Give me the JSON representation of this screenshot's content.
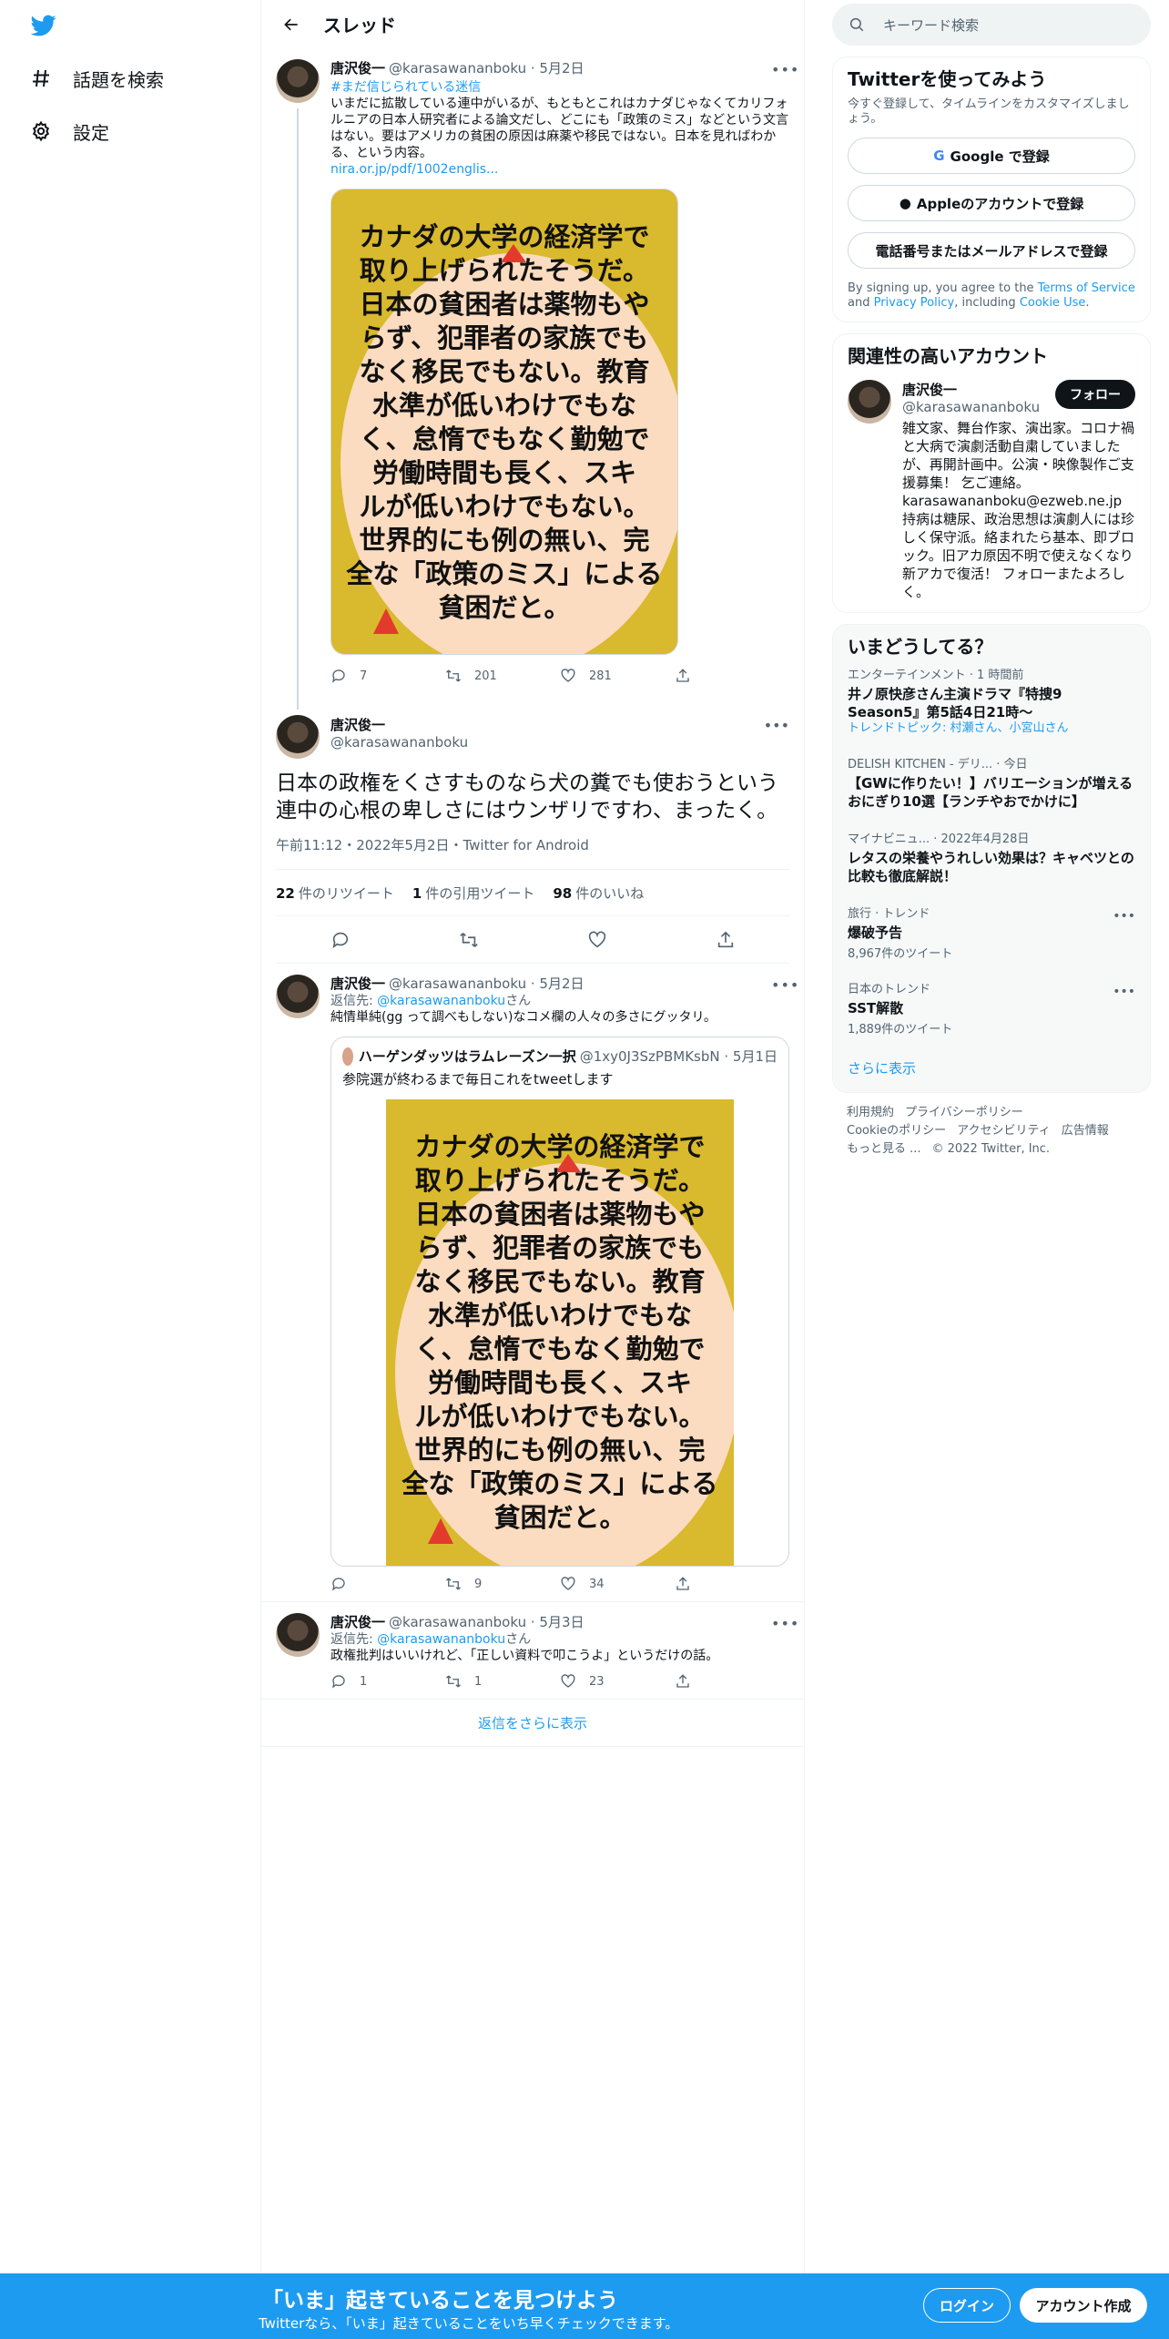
{
  "nav": {
    "explore": "話題を検索",
    "settings": "設定"
  },
  "header": {
    "title": "スレッド"
  },
  "tweet1": {
    "name": "唐沢俊一",
    "handle": "@karasawananboku · 5月2日",
    "hashtag": "#まだ信じられている迷信",
    "text": "いまだに拡散している連中がいるが、もともとこれはカナダじゃなくてカリフォルニアの日本人研究者による論文だし、どこにも「政策のミス」などという文言はない。要はアメリカの貧困の原因は麻薬や移民ではない。日本を見ればわかる、という内容。",
    "link": "nira.or.jp/pdf/1002englis...",
    "image_lines": [
      "カナダの大学の経済学で",
      "取り上げられたそうだ。",
      "日本の貧困者は薬物もや",
      "らず、犯罪者の家族でも",
      "なく移民でもない。教育",
      "水準が低いわけでもな",
      "く、怠惰でもなく勤勉で",
      "労働時間も長く、スキ",
      "ルが低いわけでもない。",
      "世界的にも例の無い、完",
      "全な「政策のミス」による",
      "貧困だと。"
    ],
    "replies": "7",
    "retweets": "201",
    "likes": "281"
  },
  "focus": {
    "name": "唐沢俊一",
    "handle": "@karasawananboku",
    "text": "日本の政権をくさすものなら犬の糞でも使おうという連中の心根の卑しさにはウンザリですわ、まったく。",
    "time": "午前11:12・2022年5月2日・Twitter for Android",
    "retweets_count": "22",
    "retweets_label": "件のリツイート",
    "quotes_count": "1",
    "quotes_label": "件の引用ツイート",
    "likes_count": "98",
    "likes_label": "件のいいね"
  },
  "reply1": {
    "name": "唐沢俊一",
    "handle": "@karasawananboku · 5月2日",
    "reply_to_prefix": "返信先: ",
    "reply_to": "@karasawananboku",
    "reply_to_suffix": "さん",
    "text": "純情単純(gg って調べもしない)なコメ欄の人々の多さにグッタリ。",
    "quote_name": "ハーゲンダッツはラムレーズン一択",
    "quote_handle": "@1xy0J3SzPBMKsbN · 5月1日",
    "quote_text": "参院選が終わるまで毎日これをtweetします",
    "replies": "",
    "retweets": "9",
    "likes": "34"
  },
  "reply2": {
    "name": "唐沢俊一",
    "handle": "@karasawananboku · 5月3日",
    "reply_to_prefix": "返信先: ",
    "reply_to": "@karasawananboku",
    "reply_to_suffix": "さん",
    "text": "政権批判はいいけれど、「正しい資料で叩こうよ」というだけの話。",
    "replies": "1",
    "retweets": "1",
    "likes": "23"
  },
  "show_more_replies": "返信をさらに表示",
  "search": {
    "placeholder": "キーワード検索"
  },
  "signup_panel": {
    "title": "Twitterを使ってみよう",
    "sub": "今すぐ登録して、タイムラインをカスタマイズしましょう。",
    "google": "Google で登録",
    "apple": "Appleのアカウントで登録",
    "phone": "電話番号またはメールアドレスで登録",
    "terms_a": "By signing up, you agree to the ",
    "terms_link1": "Terms of Service",
    "terms_b": " and ",
    "terms_link2": "Privacy Policy",
    "terms_c": ", including ",
    "terms_link3": "Cookie Use",
    "terms_d": "."
  },
  "related": {
    "title": "関連性の高いアカウント",
    "name": "唐沢俊一",
    "handle": "@karasawananboku",
    "follow": "フォロー",
    "bio": "雑文家、舞台作家、演出家。コロナ禍と大病で演劇活動自粛していましたが、再開計画中。公演・映像製作ご支援募集！ 乞ご連絡。karasawananboku@ezweb.ne.jp 持病は糖尿、政治思想は演劇人には珍しく保守派。絡まれたら基本、即ブロック。旧アカ原因不明で使えなくなり新アカで復活！ フォローまたよろしく。"
  },
  "trends": {
    "title": "いまどうしてる？",
    "items": [
      {
        "ctx": "エンターテインメント · 1 時間前",
        "title": "井ノ原快彦さん主演ドラマ『特捜9 Season5』第5話4日21時〜",
        "sub": "トレンドトピック: 村瀬さん、小宮山さん"
      },
      {
        "ctx": "DELISH KITCHEN - デリ... · 今日",
        "title": "【GWに作りたい！】バリエーションが増えるおにぎり10選【ランチやおでかけに】",
        "sub": ""
      },
      {
        "ctx": "マイナビニュ... · 2022年4月28日",
        "title": "レタスの栄養やうれしい効果は？キャベツとの比較も徹底解説！",
        "sub": ""
      },
      {
        "ctx": "旅行 · トレンド",
        "title": "爆破予告",
        "count": "8,967件のツイート"
      },
      {
        "ctx": "日本のトレンド",
        "title": "SST解散",
        "count": "1,889件のツイート"
      }
    ],
    "more": "さらに表示"
  },
  "footer": {
    "line1": [
      "利用規約",
      "プライバシーポリシー"
    ],
    "line2": [
      "Cookieのポリシー",
      "アクセシビリティ",
      "広告情報"
    ],
    "line3": [
      "もっと見る ...",
      "© 2022 Twitter, Inc."
    ]
  },
  "bottom": {
    "title": "「いま」起きていることを見つけよう",
    "sub": "Twitterなら、「いま」起きていることをいち早くチェックできます。",
    "login": "ログイン",
    "signup": "アカウント作成"
  },
  "colors": {
    "accent": "#1d9bf0",
    "text": "#0f1419",
    "muted": "#536471"
  }
}
